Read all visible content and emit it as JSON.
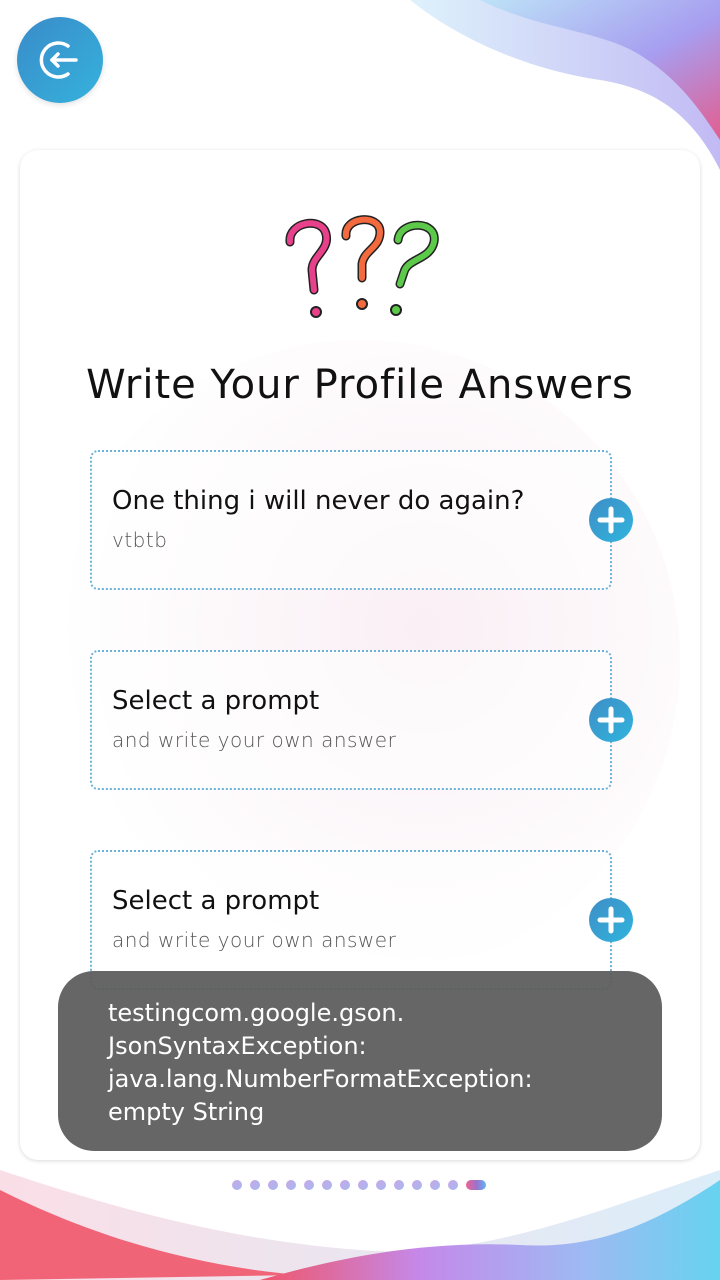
{
  "header": {
    "back_icon": "back-arrow-circle-icon"
  },
  "main": {
    "illustration_icon": "question-marks-illustration",
    "title": "Write Your Profile Answers",
    "prompts": [
      {
        "question": "One thing i will never do again?",
        "answer": "vtbtb",
        "add_icon": "plus-circle-icon"
      },
      {
        "question": "Select a prompt",
        "answer": "and write your own answer",
        "add_icon": "plus-circle-icon"
      },
      {
        "question": "Select a prompt",
        "answer": "and write your own answer",
        "add_icon": "plus-circle-icon"
      }
    ]
  },
  "toast": {
    "lines": [
      "testingcom.google.gson.",
      "JsonSyntaxException:",
      "java.lang.NumberFormatException:",
      "empty String"
    ]
  },
  "pagination": {
    "total": 14,
    "active_index": 13
  },
  "colors": {
    "accent_blue": "#35b2dc",
    "dotted_border": "#6cb2d6",
    "toast_bg": "#5a5a5a",
    "qmark_pink": "#e8418b",
    "qmark_orange": "#f26a3e",
    "qmark_green": "#5cc94a"
  }
}
